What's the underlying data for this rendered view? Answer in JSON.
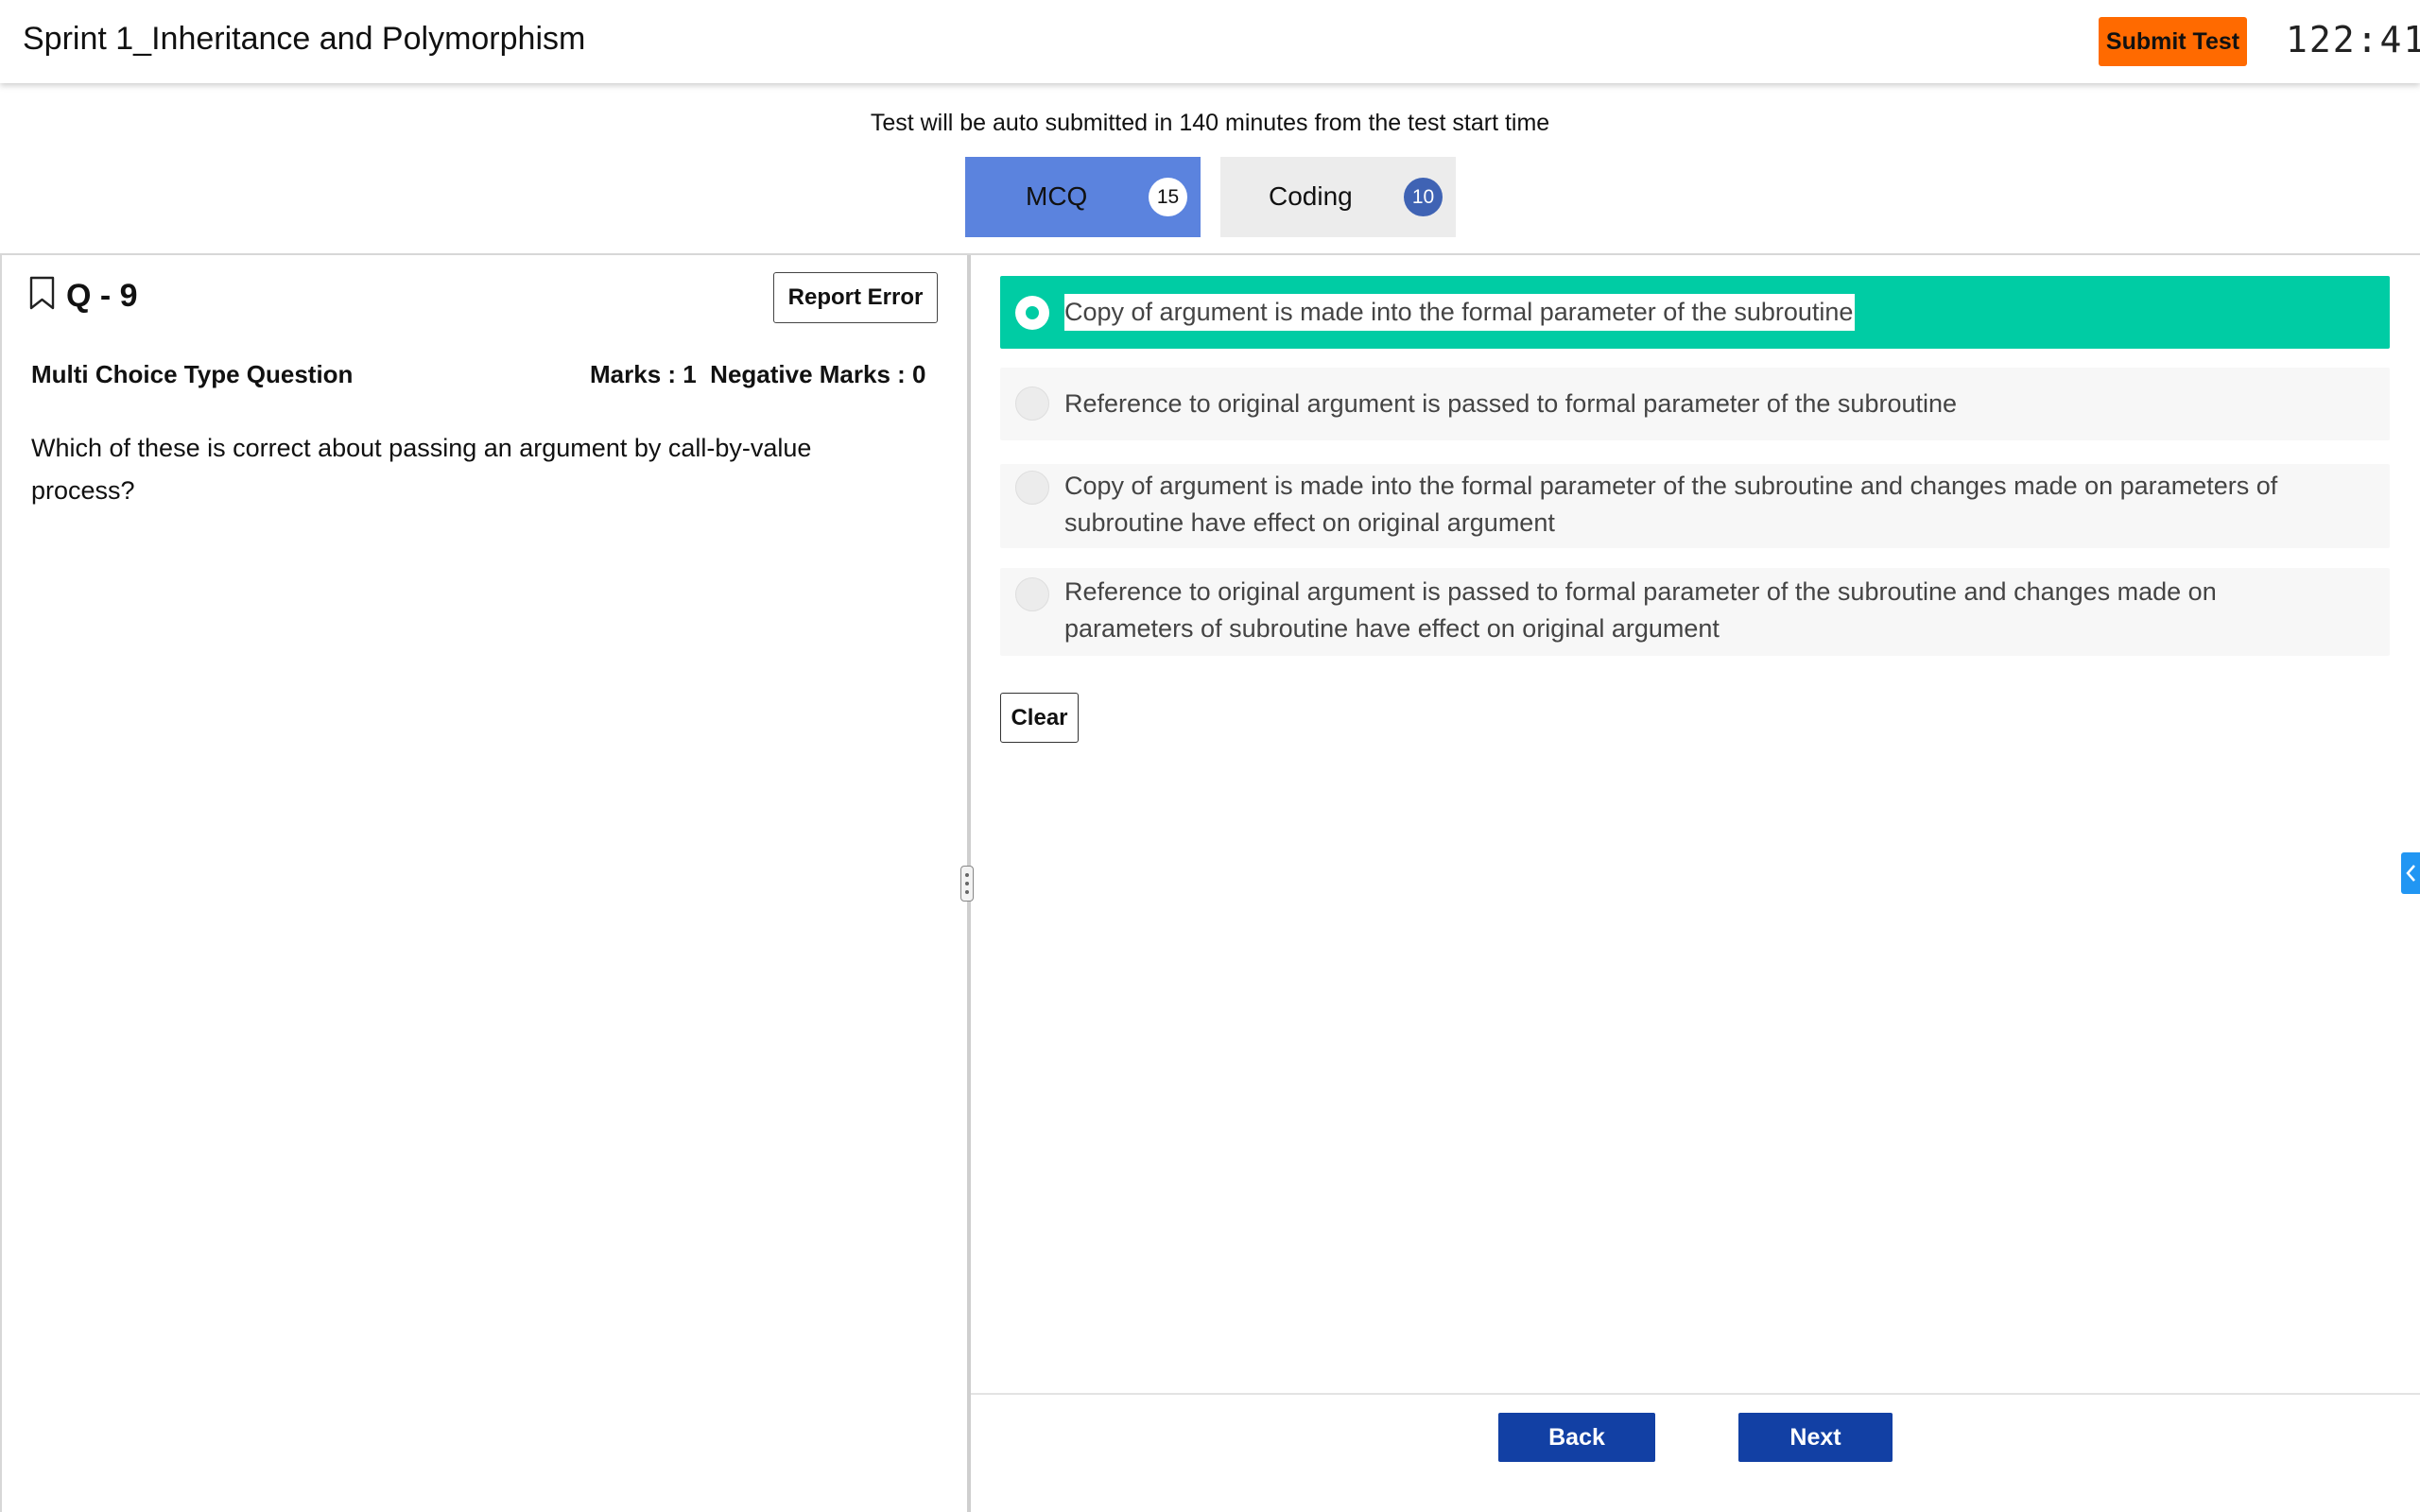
{
  "header": {
    "title": "Sprint 1_Inheritance and Polymorphism",
    "submit_label": "Submit Test",
    "timer": "122:41"
  },
  "notice": "Test will be auto submitted in 140 minutes from the test start time",
  "tabs": [
    {
      "label": "MCQ",
      "count": "15",
      "active": true
    },
    {
      "label": "Coding",
      "count": "10",
      "active": false
    }
  ],
  "question": {
    "number": "Q - 9",
    "report_label": "Report Error",
    "type": "Multi Choice Type Question",
    "marks": "Marks : 1  Negative Marks : 0",
    "text": "Which of these is correct about passing an argument by call-by-value process?"
  },
  "options": [
    {
      "text": "Copy of argument is made into the formal parameter of the subroutine",
      "selected": true
    },
    {
      "text": "Reference to original argument is passed to formal parameter of the subroutine",
      "selected": false
    },
    {
      "text": "Copy of argument is made into the formal parameter of the subroutine and changes made on parameters of subroutine have effect on original argument",
      "selected": false
    },
    {
      "text": "Reference to original argument is passed to formal parameter of the subroutine and changes made on parameters of subroutine have effect on original argument",
      "selected": false
    }
  ],
  "clear_label": "Clear",
  "nav": {
    "back_label": "Back",
    "next_label": "Next"
  },
  "colors": {
    "accent_orange": "#ff6a00",
    "selected_green": "#00cca4",
    "tab_active": "#5b83de",
    "nav_blue": "#1240a4"
  }
}
